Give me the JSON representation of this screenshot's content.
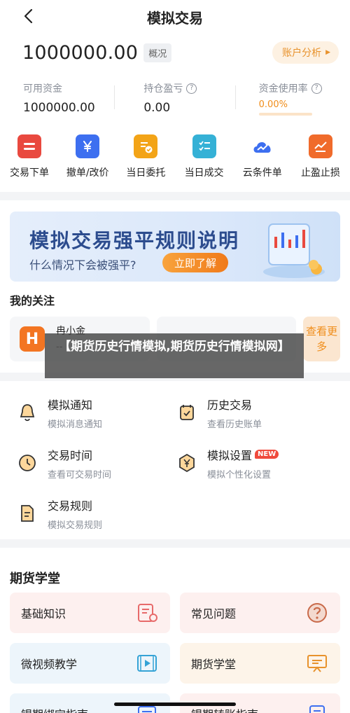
{
  "nav": {
    "title": "模拟交易"
  },
  "account": {
    "balance": "1000000.00",
    "balance_tag": "概况",
    "analysis_button": "账户分析",
    "analysis_arrow": "▶"
  },
  "stats": [
    {
      "label": "可用资金",
      "value": "1000000.00"
    },
    {
      "label": "持仓盈亏",
      "value": "0.00"
    },
    {
      "label": "资金使用率",
      "value": "0.00%"
    }
  ],
  "help_glyph": "?",
  "actions": [
    {
      "label": "交易下单",
      "icon": "order-icon",
      "color": "#e9493f"
    },
    {
      "label": "撤单/改价",
      "icon": "yen-icon",
      "color": "#3d6ff0"
    },
    {
      "label": "当日委托",
      "icon": "entrust-icon",
      "color": "#f3a417"
    },
    {
      "label": "当日成交",
      "icon": "deal-icon",
      "color": "#35b1d6"
    },
    {
      "label": "云条件单",
      "icon": "cloud-icon",
      "color": "#3d6ff0"
    },
    {
      "label": "止盈止损",
      "icon": "chart-icon",
      "color": "#f06b2b"
    }
  ],
  "banner": {
    "title": "模拟交易强平规则说明",
    "subtitle": "什么情况下会被强平?",
    "button": "立即了解"
  },
  "follow": {
    "title": "我的关注",
    "card_name": "冉小金",
    "card_code": "--",
    "logo_letter": "H",
    "more": "查看更多"
  },
  "overlay_text": "【期货历史行情模拟,期货历史行情模拟网】",
  "menu": [
    {
      "title": "模拟通知",
      "desc": "模拟消息通知",
      "icon": "bell-icon"
    },
    {
      "title": "历史交易",
      "desc": "查看历史账单",
      "icon": "history-icon"
    },
    {
      "title": "交易时间",
      "desc": "查看可交易时间",
      "icon": "clock-icon"
    },
    {
      "title": "模拟设置",
      "desc": "模拟个性化设置",
      "icon": "settings-icon",
      "tag": "NEW"
    },
    {
      "title": "交易规则",
      "desc": "模拟交易规则",
      "icon": "rules-icon"
    }
  ],
  "school": {
    "title": "期货学堂",
    "items": [
      {
        "label": "基础知识",
        "icon": "book-icon"
      },
      {
        "label": "常见问题",
        "icon": "question-icon"
      },
      {
        "label": "微视频教学",
        "icon": "video-icon"
      },
      {
        "label": "期货学堂",
        "icon": "board-icon"
      },
      {
        "label": "银期绑定指南",
        "icon": "bank-bind-icon"
      },
      {
        "label": "银期转账指南",
        "icon": "transfer-icon"
      }
    ]
  },
  "colors": {
    "accent": "#f08d1a",
    "brand_blue": "#2c4c8e",
    "danger": "#e9493f"
  }
}
